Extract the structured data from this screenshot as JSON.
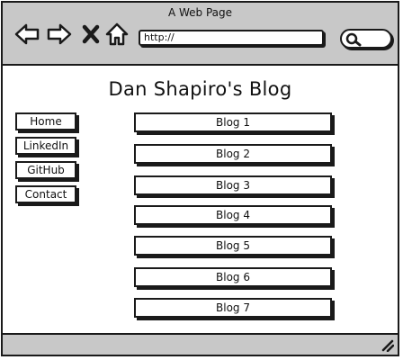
{
  "window": {
    "title": "A Web Page"
  },
  "toolbar": {
    "back_icon": "arrow-left-icon",
    "forward_icon": "arrow-right-icon",
    "stop_icon": "close-icon",
    "home_icon": "home-icon",
    "url_value": "http://",
    "search_icon": "search-icon"
  },
  "page": {
    "title": "Dan Shapiro's Blog"
  },
  "sidebar": {
    "items": [
      {
        "label": "Home"
      },
      {
        "label": "LinkedIn"
      },
      {
        "label": "GitHub"
      },
      {
        "label": "Contact"
      }
    ]
  },
  "blogs": {
    "items": [
      {
        "label": "Blog 1"
      },
      {
        "label": "Blog 2"
      },
      {
        "label": "Blog 3"
      },
      {
        "label": "Blog 4"
      },
      {
        "label": "Blog 5"
      },
      {
        "label": "Blog 6"
      },
      {
        "label": "Blog 7"
      }
    ]
  },
  "statusbar": {
    "grip_icon": "resize-grip-icon"
  }
}
